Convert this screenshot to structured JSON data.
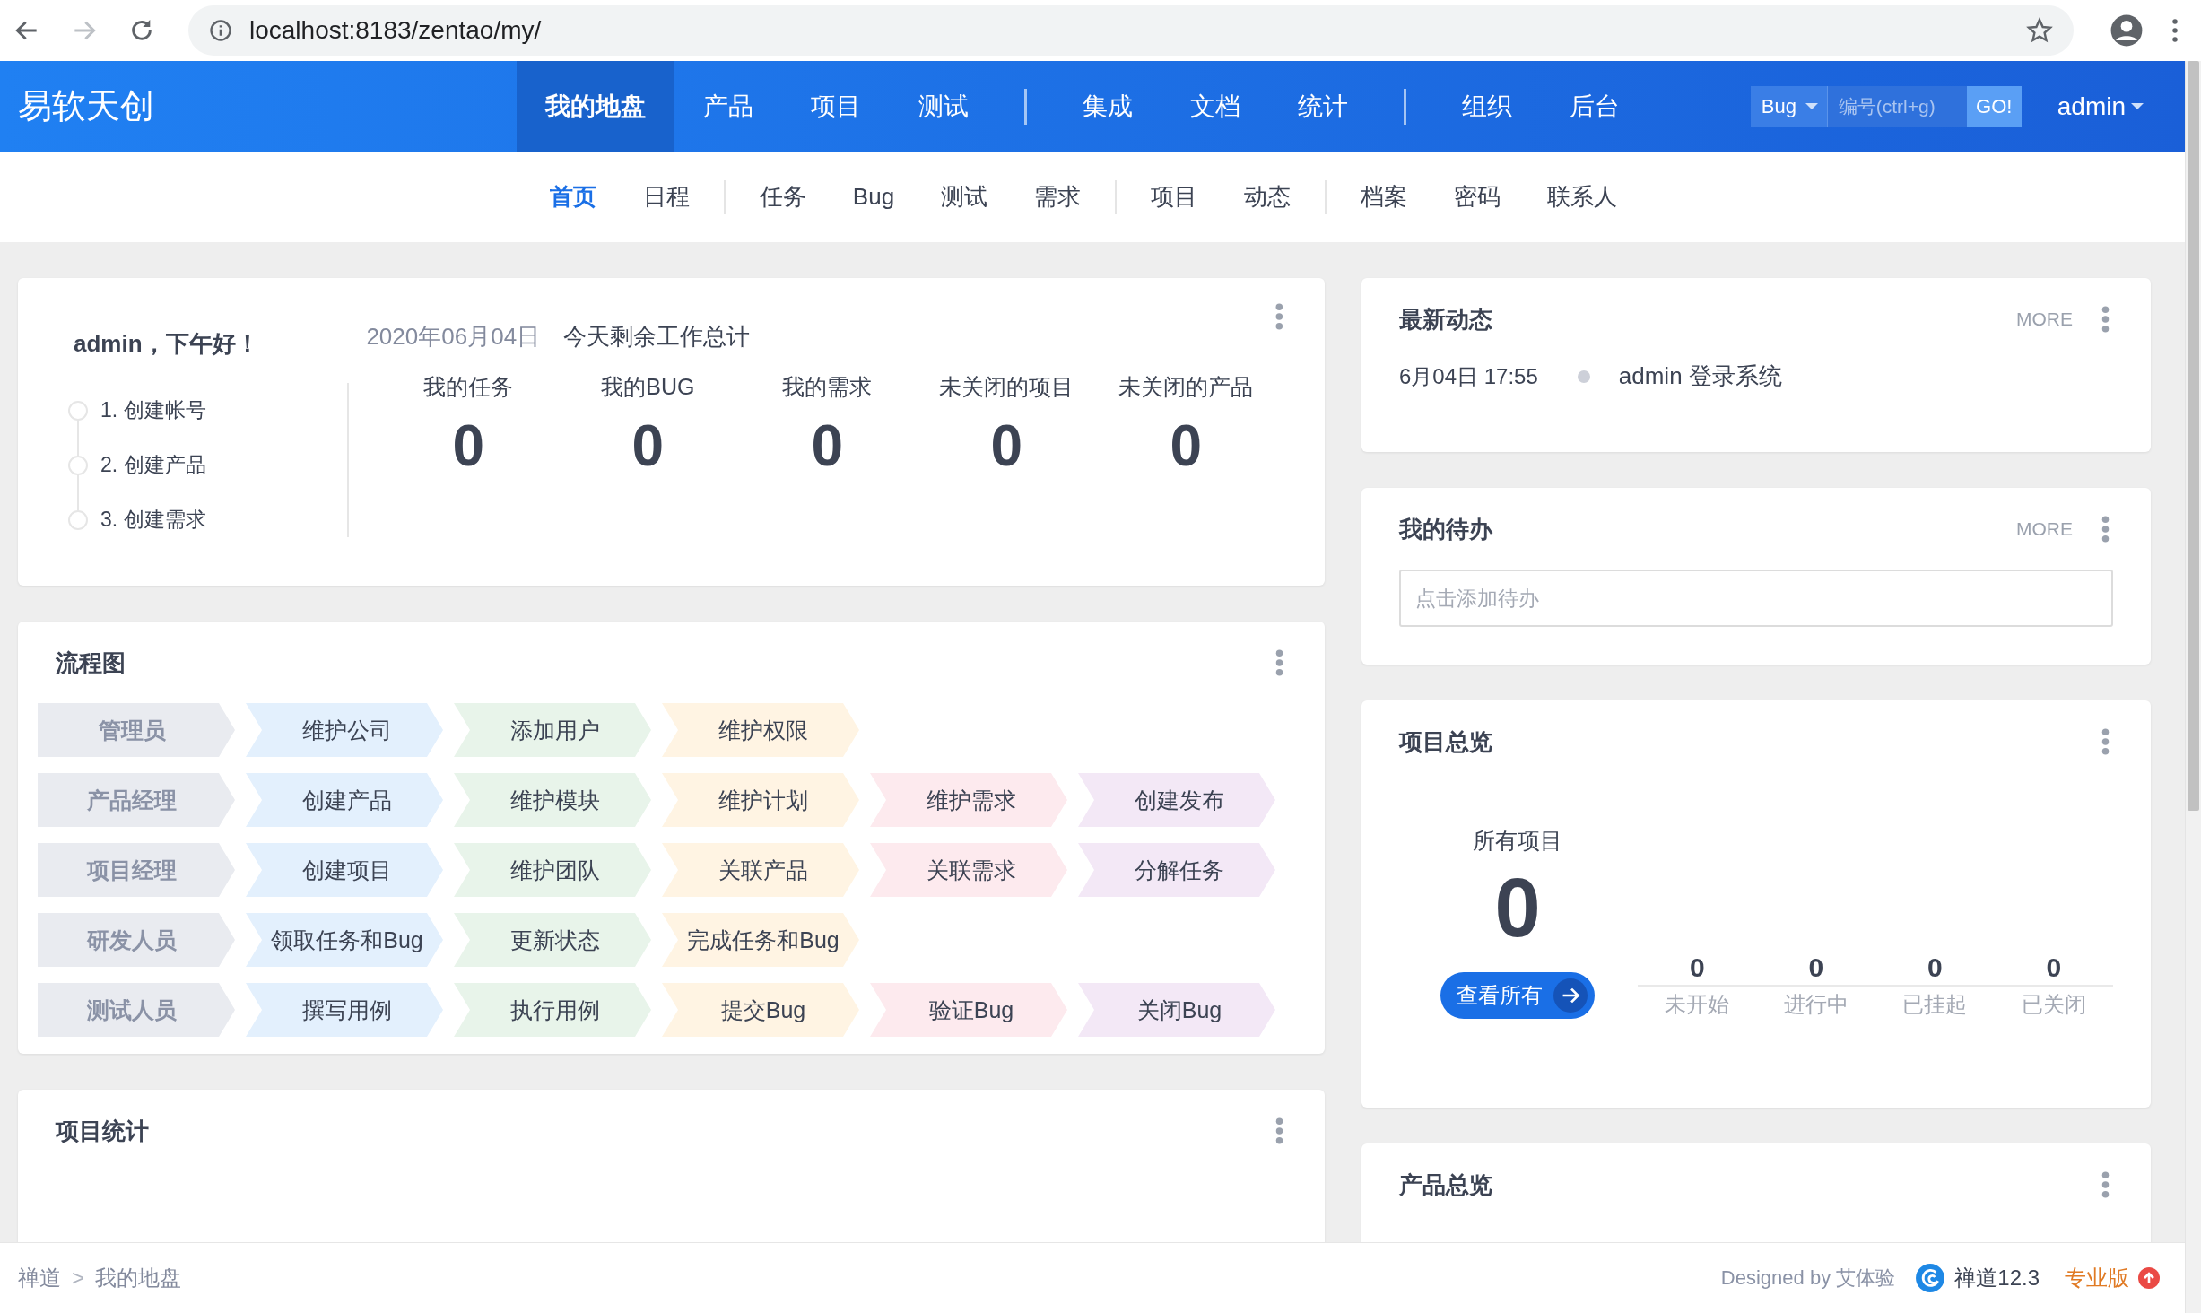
{
  "browser": {
    "url": "localhost:8183/zentao/my/",
    "forward_disabled": true
  },
  "header": {
    "logo": "易软天创",
    "nav_groups": [
      [
        {
          "label": "我的地盘",
          "selected": true
        },
        {
          "label": "产品",
          "selected": false
        },
        {
          "label": "项目",
          "selected": false
        },
        {
          "label": "测试",
          "selected": false
        }
      ],
      [
        {
          "label": "集成",
          "selected": false
        },
        {
          "label": "文档",
          "selected": false
        },
        {
          "label": "统计",
          "selected": false
        }
      ],
      [
        {
          "label": "组织",
          "selected": false
        },
        {
          "label": "后台",
          "selected": false
        }
      ]
    ],
    "search": {
      "type": "Bug",
      "placeholder": "编号(ctrl+g)",
      "button": "GO!"
    },
    "user": "admin"
  },
  "subnav": {
    "groups": [
      [
        {
          "label": "首页",
          "selected": true
        },
        {
          "label": "日程",
          "selected": false
        }
      ],
      [
        {
          "label": "任务",
          "selected": false
        },
        {
          "label": "Bug",
          "selected": false
        },
        {
          "label": "测试",
          "selected": false
        },
        {
          "label": "需求",
          "selected": false
        }
      ],
      [
        {
          "label": "项目",
          "selected": false
        },
        {
          "label": "动态",
          "selected": false
        }
      ],
      [
        {
          "label": "档案",
          "selected": false
        },
        {
          "label": "密码",
          "selected": false
        },
        {
          "label": "联系人",
          "selected": false
        }
      ]
    ]
  },
  "welcome_card": {
    "greeting": "admin，下午好！",
    "steps": [
      "1. 创建帐号",
      "2. 创建产品",
      "3. 创建需求"
    ],
    "date": "2020年06月04日",
    "summary": "今天剩余工作总计",
    "stats": [
      {
        "label": "我的任务",
        "value": "0"
      },
      {
        "label": "我的BUG",
        "value": "0"
      },
      {
        "label": "我的需求",
        "value": "0"
      },
      {
        "label": "未关闭的项目",
        "value": "0"
      },
      {
        "label": "未关闭的产品",
        "value": "0"
      }
    ]
  },
  "flow_card": {
    "title": "流程图",
    "rows": [
      {
        "role": "管理员",
        "steps": [
          {
            "label": "维护公司",
            "color": "#e3f0fd"
          },
          {
            "label": "添加用户",
            "color": "#e8f4ea"
          },
          {
            "label": "维护权限",
            "color": "#fff4e3"
          }
        ]
      },
      {
        "role": "产品经理",
        "steps": [
          {
            "label": "创建产品",
            "color": "#e3f0fd"
          },
          {
            "label": "维护模块",
            "color": "#e8f4ea"
          },
          {
            "label": "维护计划",
            "color": "#fff4e3"
          },
          {
            "label": "维护需求",
            "color": "#fdeaee"
          },
          {
            "label": "创建发布",
            "color": "#f3e8f6"
          }
        ]
      },
      {
        "role": "项目经理",
        "steps": [
          {
            "label": "创建项目",
            "color": "#e3f0fd"
          },
          {
            "label": "维护团队",
            "color": "#e8f4ea"
          },
          {
            "label": "关联产品",
            "color": "#fff4e3"
          },
          {
            "label": "关联需求",
            "color": "#fdeaee"
          },
          {
            "label": "分解任务",
            "color": "#f3e8f6"
          }
        ]
      },
      {
        "role": "研发人员",
        "steps": [
          {
            "label": "领取任务和Bug",
            "color": "#e3f0fd"
          },
          {
            "label": "更新状态",
            "color": "#e8f4ea"
          },
          {
            "label": "完成任务和Bug",
            "color": "#fff4e3"
          }
        ]
      },
      {
        "role": "测试人员",
        "steps": [
          {
            "label": "撰写用例",
            "color": "#e3f0fd"
          },
          {
            "label": "执行用例",
            "color": "#e8f4ea"
          },
          {
            "label": "提交Bug",
            "color": "#fff4e3"
          },
          {
            "label": "验证Bug",
            "color": "#fdeaee"
          },
          {
            "label": "关闭Bug",
            "color": "#f3e8f6"
          }
        ]
      }
    ]
  },
  "stats_card": {
    "title": "项目统计"
  },
  "activity_card": {
    "title": "最新动态",
    "more": "MORE",
    "items": [
      {
        "time": "6月04日 17:55",
        "text": "admin 登录系统"
      }
    ]
  },
  "todo_card": {
    "title": "我的待办",
    "more": "MORE",
    "placeholder": "点击添加待办"
  },
  "project_overview": {
    "title": "项目总览",
    "all_label": "所有项目",
    "all_value": "0",
    "button": "查看所有",
    "statuses": [
      {
        "value": "0",
        "label": "未开始"
      },
      {
        "value": "0",
        "label": "进行中"
      },
      {
        "value": "0",
        "label": "已挂起"
      },
      {
        "value": "0",
        "label": "已关闭"
      }
    ]
  },
  "product_overview": {
    "title": "产品总览"
  },
  "footer": {
    "breadcrumb": [
      "禅道",
      "我的地盘"
    ],
    "separator": ">",
    "designed_by": "Designed by 艾体验",
    "version": "禅道12.3",
    "edition": "专业版"
  }
}
